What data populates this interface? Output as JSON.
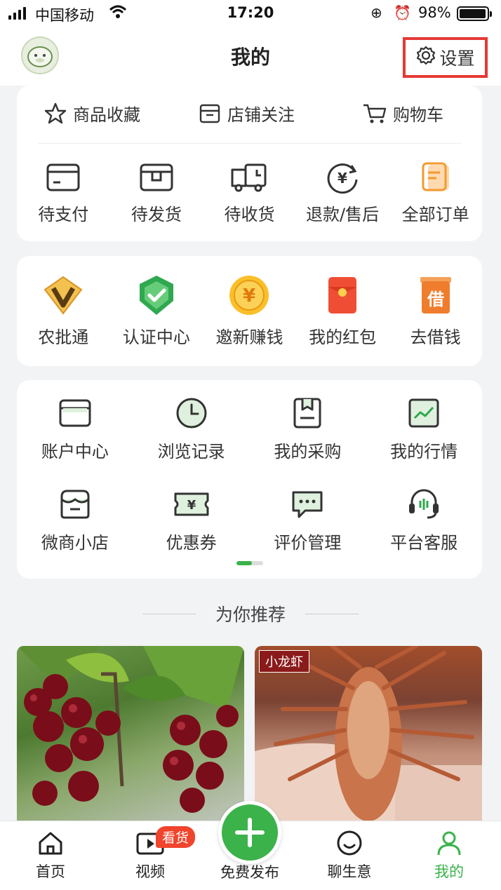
{
  "status_bar": {
    "carrier": "中国移动",
    "time": "17:20",
    "battery": "98%",
    "battery_level": 0.98
  },
  "header": {
    "title": "我的",
    "settings_label": "设置"
  },
  "shortcuts": [
    {
      "label": "商品收藏",
      "icon": "star-icon"
    },
    {
      "label": "店铺关注",
      "icon": "shop-icon"
    },
    {
      "label": "购物车",
      "icon": "cart-icon"
    }
  ],
  "orders": [
    {
      "label": "待支付",
      "icon": "card-icon"
    },
    {
      "label": "待发货",
      "icon": "package-icon"
    },
    {
      "label": "待收货",
      "icon": "truck-icon"
    },
    {
      "label": "退款/售后",
      "icon": "refund-icon"
    },
    {
      "label": "全部订单",
      "icon": "orders-icon"
    }
  ],
  "services": [
    {
      "label": "农批通",
      "icon": "diamond-v-icon"
    },
    {
      "label": "认证中心",
      "icon": "shield-check-icon"
    },
    {
      "label": "邀新赚钱",
      "icon": "coin-icon"
    },
    {
      "label": "我的红包",
      "icon": "red-envelope-icon"
    },
    {
      "label": "去借钱",
      "icon": "loan-icon",
      "glyph": "借"
    }
  ],
  "tools": [
    {
      "label": "账户中心",
      "icon": "wallet-icon"
    },
    {
      "label": "浏览记录",
      "icon": "clock-icon"
    },
    {
      "label": "我的采购",
      "icon": "purchase-icon"
    },
    {
      "label": "我的行情",
      "icon": "trend-icon"
    },
    {
      "label": "微商小店",
      "icon": "store-icon"
    },
    {
      "label": "优惠券",
      "icon": "coupon-icon"
    },
    {
      "label": "评价管理",
      "icon": "comment-icon"
    },
    {
      "label": "平台客服",
      "icon": "headset-icon"
    }
  ],
  "recommend": {
    "title": "为你推荐",
    "items": [
      {
        "tag": ""
      },
      {
        "tag": "小龙虾"
      }
    ]
  },
  "tabbar": [
    {
      "label": "首页",
      "icon": "home-icon"
    },
    {
      "label": "视频",
      "icon": "video-icon",
      "badge": "看货"
    },
    {
      "label": "免费发布",
      "icon": "plus-icon"
    },
    {
      "label": "聊生意",
      "icon": "chat-icon"
    },
    {
      "label": "我的",
      "icon": "user-icon",
      "active": true
    }
  ],
  "colors": {
    "accent": "#3bb24a",
    "highlight_box": "#e53935",
    "badge": "#f0442c"
  }
}
